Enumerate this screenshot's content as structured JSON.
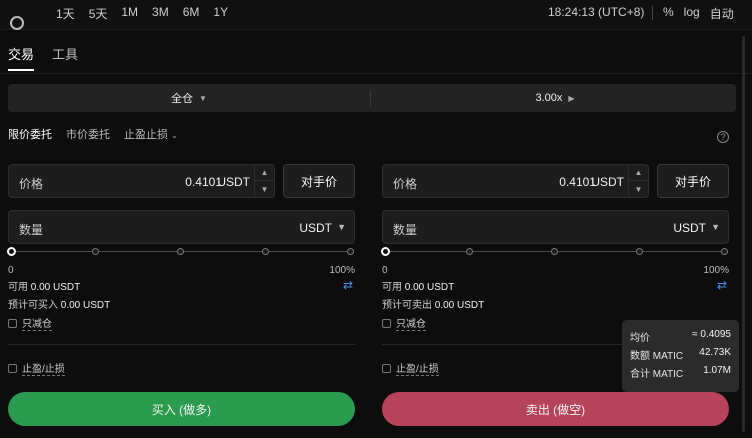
{
  "top": {
    "ranges": [
      "1天",
      "5天",
      "1M",
      "3M",
      "6M",
      "1Y"
    ],
    "clock": "18:24:13 (UTC+8)",
    "percent": "%",
    "log": "log",
    "auto": "自动"
  },
  "tabs": {
    "trade": "交易",
    "tools": "工具"
  },
  "mode": {
    "margin": "全仓",
    "leverage": "3.00x"
  },
  "order_types": {
    "limit": "限价委托",
    "market": "市价委托",
    "tpsl": "止盈止损"
  },
  "buy": {
    "price_label": "价格",
    "price_value": "0.4101",
    "price_unit": "USDT",
    "bbo": "对手价",
    "qty_label": "数量",
    "qty_unit": "USDT",
    "slider_min": "0",
    "slider_max": "100%",
    "slider_level": 0,
    "avail_label": "可用",
    "avail_value": "0.00 USDT",
    "est_label": "预计可买入",
    "est_value": "0.00 USDT",
    "reduce_only": "只减仓",
    "tpsl": "止盈/止损",
    "submit": "买入 (做多)",
    "color": "#2a9b4f"
  },
  "sell": {
    "price_label": "价格",
    "price_value": "0.4101",
    "price_unit": "USDT",
    "bbo": "对手价",
    "qty_label": "数量",
    "qty_unit": "USDT",
    "slider_min": "0",
    "slider_max": "100%",
    "slider_level": 0,
    "avail_label": "可用",
    "avail_value": "0.00 USDT",
    "est_label": "预计可卖出",
    "est_value": "0.00 USDT",
    "reduce_only": "只减仓",
    "tpsl": "止盈/止损",
    "submit": "卖出 (做空)",
    "color": "#b7435b"
  },
  "tooltip": {
    "avg_label": "均价",
    "avg_value": "≈ 0.4095",
    "amount_label": "数额 MATIC",
    "amount_value": "42.73K",
    "total_label": "合计 MATIC",
    "total_value": "1.07M"
  }
}
